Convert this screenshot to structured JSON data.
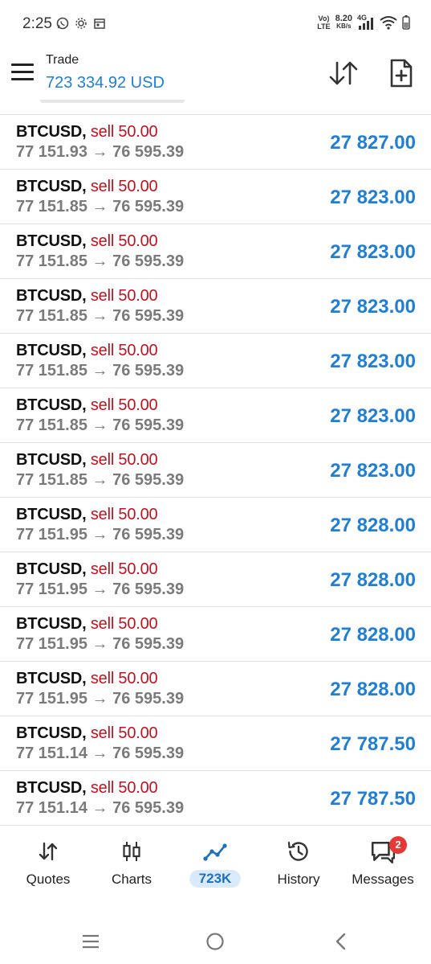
{
  "status_bar": {
    "time": "2:25",
    "network_label_top": "Vo)",
    "network_label_bottom": "LTE",
    "speed_value": "8.20",
    "speed_unit": "KB/s",
    "generation": "4G",
    "left_icons": [
      "whatsapp-icon",
      "settings-gear-icon",
      "calendar-icon"
    ]
  },
  "header": {
    "title": "Trade",
    "balance": "723 334.92 USD"
  },
  "positions": [
    {
      "symbol": "BTCUSD",
      "side": "sell 50.00",
      "open": "77 151.93",
      "arrow": "→",
      "current": "76 595.39",
      "profit": "27 827.00"
    },
    {
      "symbol": "BTCUSD",
      "side": "sell 50.00",
      "open": "77 151.85",
      "arrow": "→",
      "current": "76 595.39",
      "profit": "27 823.00"
    },
    {
      "symbol": "BTCUSD",
      "side": "sell 50.00",
      "open": "77 151.85",
      "arrow": "→",
      "current": "76 595.39",
      "profit": "27 823.00"
    },
    {
      "symbol": "BTCUSD",
      "side": "sell 50.00",
      "open": "77 151.85",
      "arrow": "→",
      "current": "76 595.39",
      "profit": "27 823.00"
    },
    {
      "symbol": "BTCUSD",
      "side": "sell 50.00",
      "open": "77 151.85",
      "arrow": "→",
      "current": "76 595.39",
      "profit": "27 823.00"
    },
    {
      "symbol": "BTCUSD",
      "side": "sell 50.00",
      "open": "77 151.85",
      "arrow": "→",
      "current": "76 595.39",
      "profit": "27 823.00"
    },
    {
      "symbol": "BTCUSD",
      "side": "sell 50.00",
      "open": "77 151.85",
      "arrow": "→",
      "current": "76 595.39",
      "profit": "27 823.00"
    },
    {
      "symbol": "BTCUSD",
      "side": "sell 50.00",
      "open": "77 151.95",
      "arrow": "→",
      "current": "76 595.39",
      "profit": "27 828.00"
    },
    {
      "symbol": "BTCUSD",
      "side": "sell 50.00",
      "open": "77 151.95",
      "arrow": "→",
      "current": "76 595.39",
      "profit": "27 828.00"
    },
    {
      "symbol": "BTCUSD",
      "side": "sell 50.00",
      "open": "77 151.95",
      "arrow": "→",
      "current": "76 595.39",
      "profit": "27 828.00"
    },
    {
      "symbol": "BTCUSD",
      "side": "sell 50.00",
      "open": "77 151.95",
      "arrow": "→",
      "current": "76 595.39",
      "profit": "27 828.00"
    },
    {
      "symbol": "BTCUSD",
      "side": "sell 50.00",
      "open": "77 151.14",
      "arrow": "→",
      "current": "76 595.39",
      "profit": "27 787.50"
    },
    {
      "symbol": "BTCUSD",
      "side": "sell 50.00",
      "open": "77 151.14",
      "arrow": "→",
      "current": "76 595.39",
      "profit": "27 787.50"
    }
  ],
  "bottom_nav": {
    "items": [
      {
        "label": "Quotes",
        "icon": "quotes-arrows-icon"
      },
      {
        "label": "Charts",
        "icon": "candlestick-icon"
      },
      {
        "label": "723K",
        "icon": "trade-line-icon",
        "active": true
      },
      {
        "label": "History",
        "icon": "history-clock-icon"
      },
      {
        "label": "Messages",
        "icon": "messages-icon",
        "badge": "2"
      }
    ]
  },
  "colors": {
    "accent_blue": "#1f7fd6",
    "sell_red": "#c1121f",
    "badge_red": "#e53935",
    "price_gray": "#7a7a7a"
  }
}
